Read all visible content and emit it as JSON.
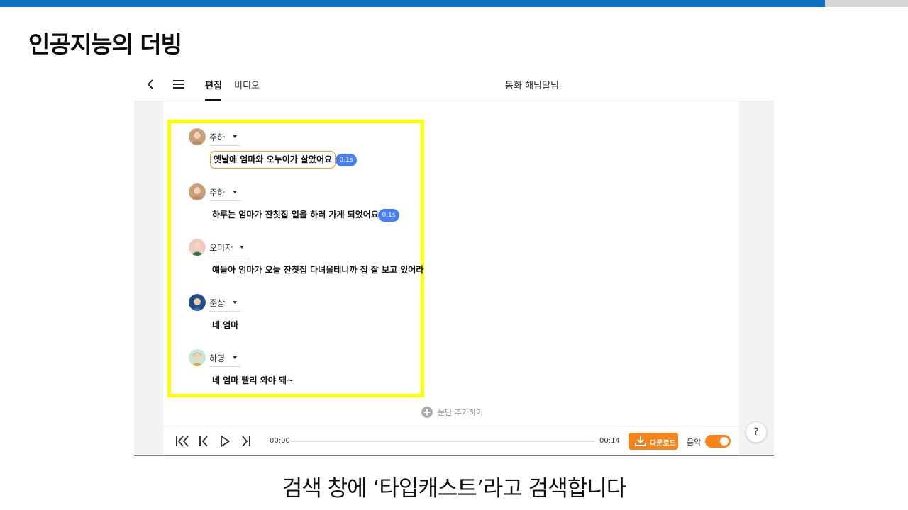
{
  "slide": {
    "title": "인공지능의 더빙",
    "caption": "검색 창에 ‘타입캐스트’라고 검색합니다",
    "accent_color": "#0b6fc2",
    "highlight_color": "#ffff00"
  },
  "header": {
    "back_icon": "chevron-left-icon",
    "menu_icon": "hamburger-menu-icon",
    "tabs": [
      {
        "label": "편집",
        "active": true
      },
      {
        "label": "비디오",
        "active": false
      }
    ],
    "document_title": "동화 해님달님"
  },
  "script_lines": [
    {
      "speaker": "주하",
      "text": "옛날에 엄마와 오누이가 살았어요",
      "pause": "0.1s",
      "selected": true
    },
    {
      "speaker": "주하",
      "text": "하루는 엄마가 잔칫집 일을 하러 가게 되었어요",
      "pause": "0.1s",
      "selected": false
    },
    {
      "speaker": "오미자",
      "text": "얘들아 엄마가 오늘 잔칫집 다녀올테니까 집 잘 보고 있어라",
      "pause": null,
      "selected": false
    },
    {
      "speaker": "준상",
      "text": "네 엄마",
      "pause": null,
      "selected": false
    },
    {
      "speaker": "하영",
      "text": "네 엄마 빨리 와야 돼~",
      "pause": null,
      "selected": false
    }
  ],
  "add_paragraph": {
    "icon": "plus-circle-icon",
    "label": "문단 추가하기"
  },
  "player": {
    "current_time": "00:00",
    "total_time": "00:14",
    "progress": 0,
    "download_label": "다운로드",
    "music_label": "음악",
    "music_on": true,
    "accent_color": "#f5841b"
  },
  "help": {
    "label": "?"
  }
}
